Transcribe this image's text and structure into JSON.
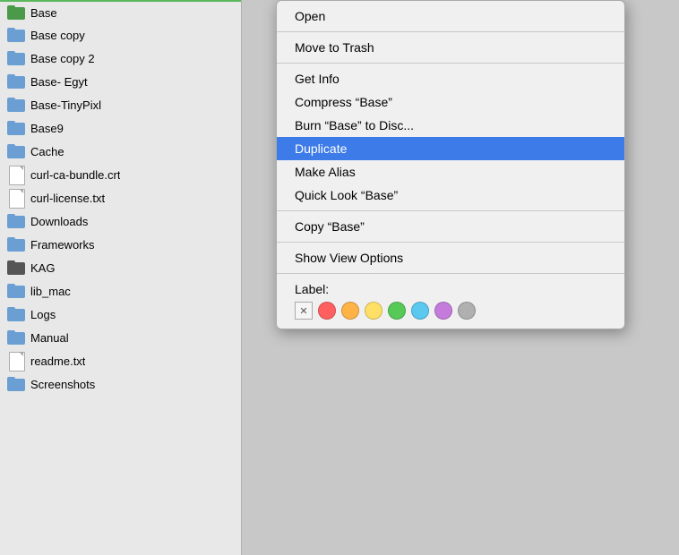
{
  "finder": {
    "items": [
      {
        "label": "Base",
        "type": "folder",
        "variant": "green-top",
        "selected": true
      },
      {
        "label": "Base copy",
        "type": "folder",
        "variant": "normal"
      },
      {
        "label": "Base copy 2",
        "type": "folder",
        "variant": "normal"
      },
      {
        "label": "Base- Egyt",
        "type": "folder",
        "variant": "normal"
      },
      {
        "label": "Base-TinyPixl",
        "type": "folder",
        "variant": "normal"
      },
      {
        "label": "Base9",
        "type": "folder",
        "variant": "normal"
      },
      {
        "label": "Cache",
        "type": "folder",
        "variant": "normal"
      },
      {
        "label": "curl-ca-bundle.crt",
        "type": "file",
        "variant": "normal"
      },
      {
        "label": "curl-license.txt",
        "type": "file",
        "variant": "normal"
      },
      {
        "label": "Downloads",
        "type": "folder",
        "variant": "normal"
      },
      {
        "label": "Frameworks",
        "type": "folder",
        "variant": "normal"
      },
      {
        "label": "KAG",
        "type": "folder",
        "variant": "dark"
      },
      {
        "label": "lib_mac",
        "type": "folder",
        "variant": "normal"
      },
      {
        "label": "Logs",
        "type": "folder",
        "variant": "normal"
      },
      {
        "label": "Manual",
        "type": "folder",
        "variant": "normal"
      },
      {
        "label": "readme.txt",
        "type": "file",
        "variant": "normal"
      },
      {
        "label": "Screenshots",
        "type": "folder",
        "variant": "normal"
      }
    ]
  },
  "context_menu": {
    "items": [
      {
        "label": "Open",
        "type": "item",
        "highlighted": false
      },
      {
        "type": "separator"
      },
      {
        "label": "Move to Trash",
        "type": "item",
        "highlighted": false
      },
      {
        "type": "separator"
      },
      {
        "label": "Get Info",
        "type": "item",
        "highlighted": false
      },
      {
        "label": "Compress “Base”",
        "type": "item",
        "highlighted": false
      },
      {
        "label": "Burn “Base” to Disc...",
        "type": "item",
        "highlighted": false
      },
      {
        "label": "Duplicate",
        "type": "item",
        "highlighted": true
      },
      {
        "label": "Make Alias",
        "type": "item",
        "highlighted": false
      },
      {
        "label": "Quick Look “Base”",
        "type": "item",
        "highlighted": false
      },
      {
        "type": "separator"
      },
      {
        "label": "Copy “Base”",
        "type": "item",
        "highlighted": false
      },
      {
        "type": "separator"
      },
      {
        "label": "Show View Options",
        "type": "item",
        "highlighted": false
      },
      {
        "type": "separator"
      },
      {
        "label": "Label:",
        "type": "label-row"
      }
    ]
  },
  "label_colors": [
    "#ff5f5f",
    "#ffb347",
    "#ffe066",
    "#57c957",
    "#5bc8ef",
    "#c57bdb",
    "#b0b0b0"
  ],
  "label_section": "Label:"
}
